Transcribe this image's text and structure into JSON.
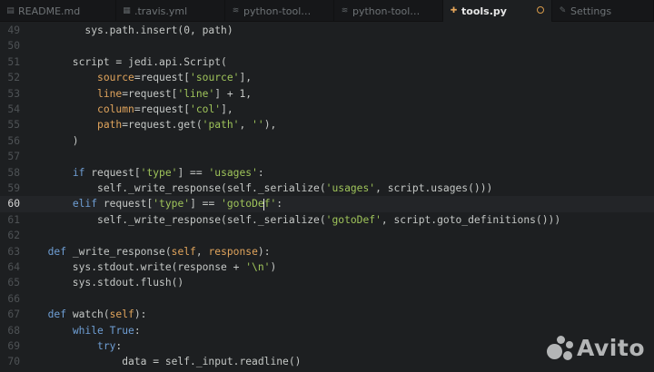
{
  "tabs": [
    {
      "label": "README.md",
      "icon": "document-icon",
      "active": false,
      "modified": false
    },
    {
      "label": ".travis.yml",
      "icon": "yaml-icon",
      "active": false,
      "modified": false
    },
    {
      "label": "python-tool…",
      "icon": "database-icon",
      "active": false,
      "modified": false
    },
    {
      "label": "python-tool…",
      "icon": "database-icon",
      "active": false,
      "modified": false
    },
    {
      "label": "tools.py",
      "icon": "python-icon",
      "active": true,
      "modified": true
    },
    {
      "label": "Settings",
      "icon": "wrench-icon",
      "active": false,
      "modified": false
    }
  ],
  "editor": {
    "language": "python",
    "current_line": 60,
    "lines": [
      {
        "n": "49",
        "code": "        sys.path.insert(0, path)"
      },
      {
        "n": "50",
        "code": ""
      },
      {
        "n": "51",
        "code": "      script = jedi.api.Script("
      },
      {
        "n": "52",
        "code": "          source=request['source'],"
      },
      {
        "n": "53",
        "code": "          line=request['line'] + 1,"
      },
      {
        "n": "54",
        "code": "          column=request['col'],"
      },
      {
        "n": "55",
        "code": "          path=request.get('path', ''),"
      },
      {
        "n": "56",
        "code": "      )"
      },
      {
        "n": "57",
        "code": ""
      },
      {
        "n": "58",
        "code": "      if request['type'] == 'usages':"
      },
      {
        "n": "59",
        "code": "          self._write_response(self._serialize('usages', script.usages()))"
      },
      {
        "n": "60",
        "code": "      elif request['type'] == 'gotoDef':"
      },
      {
        "n": "61",
        "code": "          self._write_response(self._serialize('gotoDef', script.goto_definitions()))"
      },
      {
        "n": "62",
        "code": ""
      },
      {
        "n": "63",
        "code": "  def _write_response(self, response):"
      },
      {
        "n": "64",
        "code": "      sys.stdout.write(response + '\\n')"
      },
      {
        "n": "65",
        "code": "      sys.stdout.flush()"
      },
      {
        "n": "66",
        "code": ""
      },
      {
        "n": "67",
        "code": "  def watch(self):"
      },
      {
        "n": "68",
        "code": "      while True:"
      },
      {
        "n": "69",
        "code": "          try:"
      },
      {
        "n": "70",
        "code": "              data = self._input.readline()"
      }
    ]
  },
  "watermark": {
    "text": "Avito",
    "icon": "avito-logo-icon"
  },
  "colors": {
    "background": "#1d1f21",
    "keyword": "#6f9fd5",
    "string": "#9fc45a",
    "parameter": "#e0a45c",
    "text": "#c5c8c6",
    "gutter": "#4e5255",
    "modified_indicator": "#d79a4a"
  }
}
